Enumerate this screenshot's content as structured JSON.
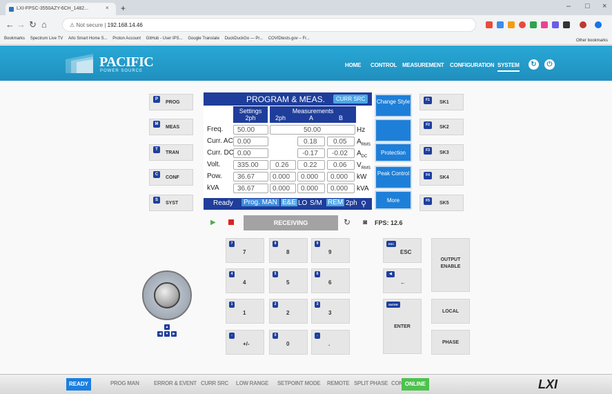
{
  "browser": {
    "tab_title": "LXI-FPSC-3550AZY-6CH_1482...",
    "tab_close": "×",
    "new_tab": "+",
    "win_min": "–",
    "win_max": "□",
    "win_close": "×",
    "not_secure": "Not secure",
    "url": "192.168.14.46",
    "bookmarks": [
      "Bookmarks",
      "Spectrum Live TV",
      "Arlo Smart Home S...",
      "Proton Account",
      "GitHub - User IPS...",
      "Google Translate",
      "DuckDuckGo — Pr...",
      "COVIDtests.gov – Fr..."
    ],
    "other_bookmarks": "Other bookmarks"
  },
  "header": {
    "logo": "PACIFIC",
    "logo_sub": "POWER SOURCE",
    "nav": [
      "HOME",
      "CONTROL",
      "MEASUREMENT",
      "CONFIGURATION",
      "SYSTEM"
    ]
  },
  "sidebar": [
    {
      "key": "P",
      "label": "PROG"
    },
    {
      "key": "M",
      "label": "MEAS"
    },
    {
      "key": "T",
      "label": "TRAN"
    },
    {
      "key": "C",
      "label": "CONF"
    },
    {
      "key": "S",
      "label": "SYST"
    }
  ],
  "panel": {
    "title": "PROGRAM & MEAS.",
    "curr_src": "CURR SRC",
    "settings_hdr": "Settings",
    "settings_sub": "2ph",
    "meas_hdr": "Measurements",
    "meas_sub": [
      "2ph",
      "A",
      "B"
    ],
    "rows": [
      {
        "label": "Freq.",
        "setting": "50.00",
        "meas": [
          "50.00"
        ],
        "unit": "Hz",
        "unit_sub": ""
      },
      {
        "label": "Curr. AC",
        "setting": "0.00",
        "meas": [
          "",
          "0.18",
          "0.05"
        ],
        "unit": "A",
        "unit_sub": "RMS"
      },
      {
        "label": "Curr. DC",
        "setting": "0.00",
        "meas": [
          "",
          "-0.17",
          "-0.02"
        ],
        "unit": "A",
        "unit_sub": "DC"
      },
      {
        "label": "Volt.",
        "setting": "335.00",
        "meas": [
          "0.26",
          "0.22",
          "0.06"
        ],
        "unit": "V",
        "unit_sub": "RMS"
      },
      {
        "label": "Pow.",
        "setting": "36.67",
        "meas": [
          "0.000",
          "0.000",
          "0.000"
        ],
        "unit": "kW",
        "unit_sub": ""
      },
      {
        "label": "kVA",
        "setting": "36.67",
        "meas": [
          "0.000",
          "0.000",
          "0.000"
        ],
        "unit": "kVA",
        "unit_sub": ""
      }
    ],
    "status": [
      "Ready",
      "Prog. MAN",
      "E&E",
      "LO",
      "S/M",
      "REM",
      "2ph"
    ]
  },
  "right_buttons": [
    "Change Style",
    "",
    "Protection",
    "Peak Control",
    "More"
  ],
  "softkeys": [
    {
      "key": "F1",
      "label": "SK1"
    },
    {
      "key": "F2",
      "label": "SK2"
    },
    {
      "key": "F3",
      "label": "SK3"
    },
    {
      "key": "F4",
      "label": "SK4"
    },
    {
      "key": "F5",
      "label": "SK5"
    }
  ],
  "controls": {
    "receiving": "RECEIVING",
    "fps": "FPS: 12.6"
  },
  "keypad": {
    "digits": [
      {
        "key": "7",
        "label": "7"
      },
      {
        "key": "8",
        "label": "8"
      },
      {
        "key": "9",
        "label": "9"
      },
      {
        "key": "4",
        "label": "4"
      },
      {
        "key": "5",
        "label": "5"
      },
      {
        "key": "6",
        "label": "6"
      },
      {
        "key": "1",
        "label": "1"
      },
      {
        "key": "2",
        "label": "2"
      },
      {
        "key": "3",
        "label": "3"
      },
      {
        "key": "-",
        "label": "+/-"
      },
      {
        "key": "0",
        "label": "0"
      },
      {
        "key": ".",
        "label": "."
      }
    ],
    "esc_key": "ESC",
    "esc_label": "ESC",
    "back_label": "←",
    "enter_key": "ENTER",
    "enter_label": "ENTER",
    "output_enable": "OUTPUT ENABLE",
    "local": "LOCAL",
    "phase": "PHASE"
  },
  "footer": {
    "ready": "READY",
    "items": [
      "PROG MAN",
      "ERROR & EVENT",
      "CURR SRC",
      "LOW RANGE",
      "SETPOINT MODE",
      "REMOTE",
      "SPLIT PHASE",
      "CONTROL"
    ],
    "online": "ONLINE",
    "lxi": "LXI"
  },
  "colors": {
    "header_blue": "#2199c9",
    "panel_navy": "#1f3d9a",
    "button_blue": "#1e7fd8",
    "ready_blue": "#1a7fe0",
    "online_green": "#4dc24d"
  }
}
